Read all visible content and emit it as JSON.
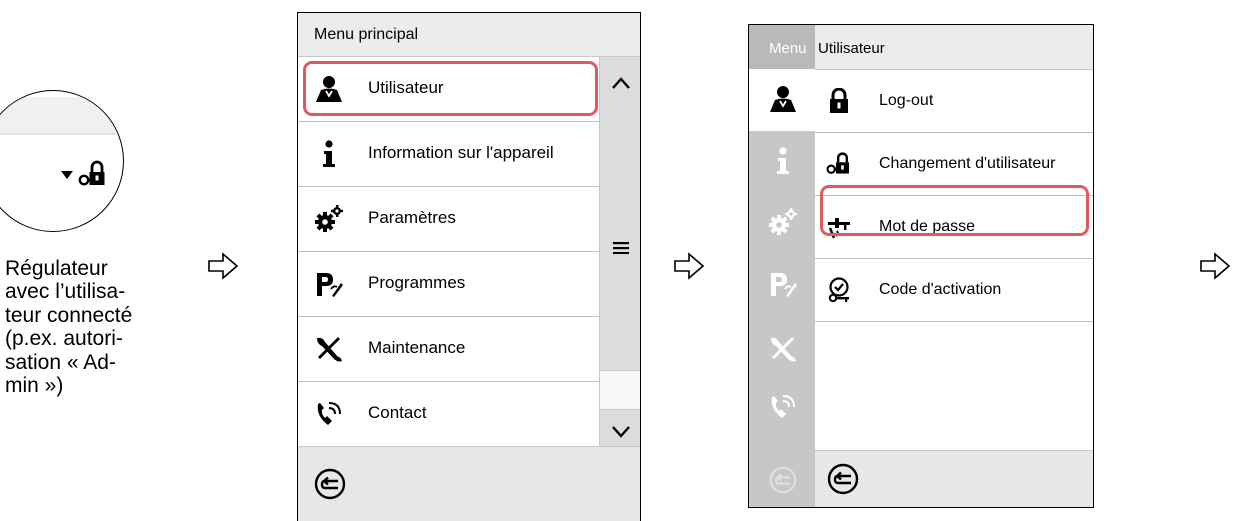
{
  "caption": {
    "lines": [
      "Régulateur",
      "avec l’utilisa-",
      "teur connecté",
      "(p.ex. autori-",
      "sation « Ad-",
      "min »)"
    ]
  },
  "controller": {
    "icons": [
      "dropdown-arrow-icon",
      "user-lock-icon"
    ]
  },
  "main_menu": {
    "title": "Menu principal",
    "items": [
      {
        "label": "Utilisateur",
        "icon": "user-icon",
        "highlighted": true
      },
      {
        "label": "Information sur l'appareil",
        "icon": "info-icon"
      },
      {
        "label": "Paramètres",
        "icon": "gears-icon"
      },
      {
        "label": "Programmes",
        "icon": "programs-icon"
      },
      {
        "label": "Maintenance",
        "icon": "tools-icon"
      },
      {
        "label": "Contact",
        "icon": "phone-icon"
      }
    ],
    "scrollbar_icons": [
      "chevron-up-icon",
      "menu-lines-icon",
      "chevron-down-icon"
    ]
  },
  "user_menu": {
    "side_title": "Menu",
    "title": "Utilisateur",
    "items": [
      {
        "label": "Log-out",
        "icon": "lock-icon"
      },
      {
        "label": "Changement d'utilisateur",
        "icon": "user-lock-icon"
      },
      {
        "label": "Mot de passe",
        "icon": "password-key-icon",
        "highlighted": true
      },
      {
        "label": "Code d'activation",
        "icon": "activation-key-icon"
      }
    ]
  },
  "colors": {
    "highlight": "#e05a5e",
    "sidebar": "#c7c7c7",
    "titlebar": "#ececec"
  }
}
